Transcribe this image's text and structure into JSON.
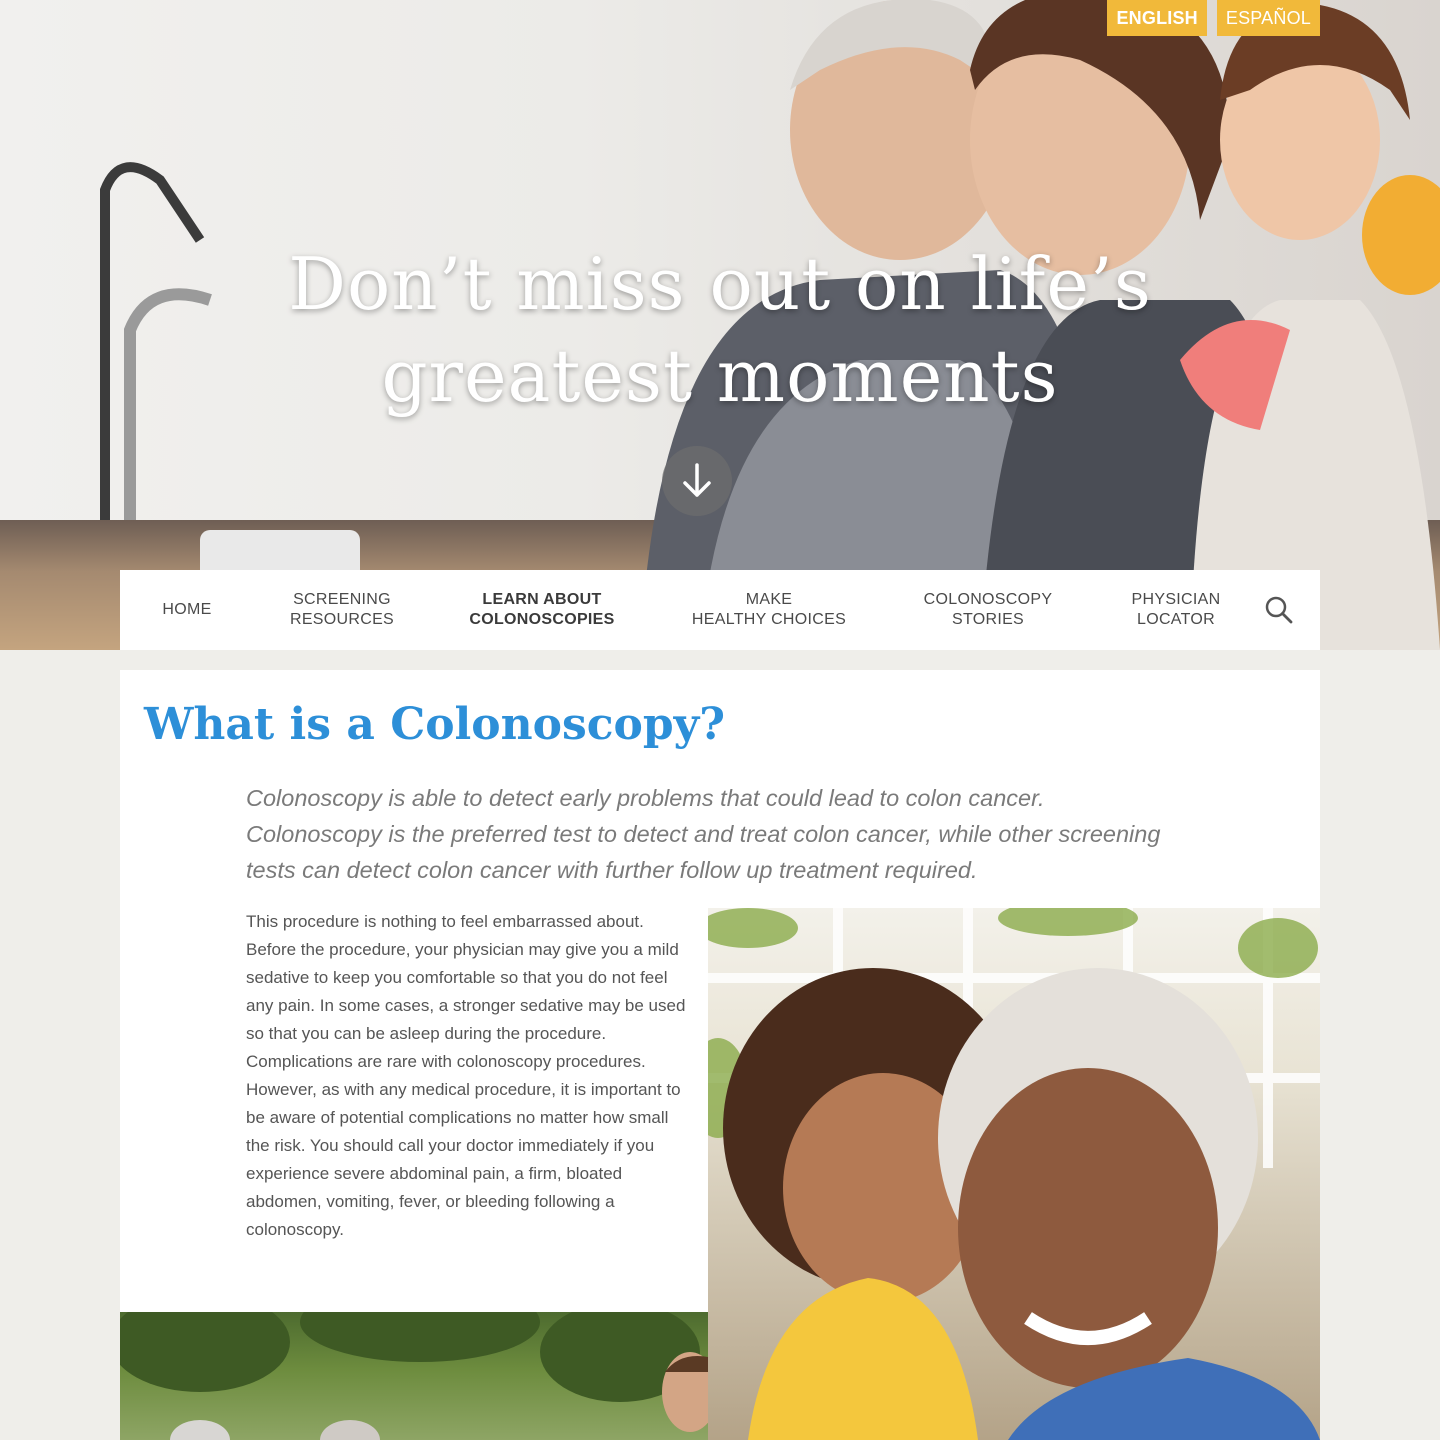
{
  "language": {
    "english_label": "ENGLISH",
    "spanish_label": "ESPAÑOL"
  },
  "hero": {
    "title_line1": "Don’t miss out on life’s",
    "title_line2": "greatest moments"
  },
  "nav": {
    "items": [
      {
        "line1": "HOME",
        "line2": ""
      },
      {
        "line1": "SCREENING",
        "line2": "RESOURCES"
      },
      {
        "line1": "LEARN ABOUT",
        "line2": "COLONOSCOPIES"
      },
      {
        "line1": "MAKE",
        "line2": "HEALTHY CHOICES"
      },
      {
        "line1": "COLONOSCOPY",
        "line2": "STORIES"
      },
      {
        "line1": "PHYSICIAN",
        "line2": "LOCATOR"
      }
    ],
    "active_index": 2,
    "search_icon": "search-icon"
  },
  "content": {
    "title": "What is a Colonoscopy?",
    "intro": "Colonoscopy is able to detect early problems that could lead to colon cancer. Colonoscopy is the preferred test to detect and treat colon cancer, while other screening tests can detect colon cancer with further follow up treatment required.",
    "body": "This procedure is nothing to feel embarrassed about. Before the procedure, your physician may give you a mild sedative to keep you comfortable so that you do not feel any pain. In some cases, a stronger sedative may be used so that you can be asleep during the procedure. Complications are rare with colonoscopy procedures. However, as with any medical procedure, it is important to be aware of potential complications no matter how small the risk. You should call your doctor immediately if you experience severe abdominal pain, a firm, bloated abdomen, vomiting, fever, or bleeding following a colonoscopy."
  },
  "colors": {
    "accent_yellow": "#f1b93a",
    "title_blue": "#2d8fd8",
    "page_background": "#efeeea"
  }
}
